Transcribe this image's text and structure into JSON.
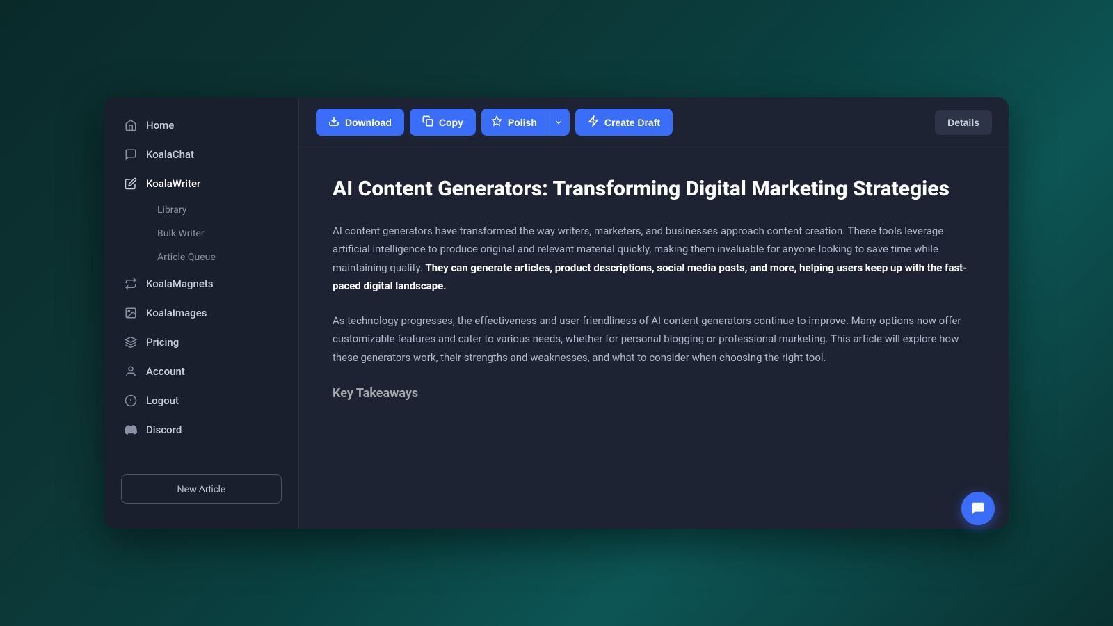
{
  "sidebar": {
    "items": [
      {
        "id": "home",
        "label": "Home",
        "icon": "home"
      },
      {
        "id": "koalachat",
        "label": "KoalaChat",
        "icon": "chat"
      },
      {
        "id": "koalawriter",
        "label": "KoalaWriter",
        "icon": "write"
      },
      {
        "id": "koalamagnets",
        "label": "KoalaMagnets",
        "icon": "magnets"
      },
      {
        "id": "koalaimages",
        "label": "KoalaImages",
        "icon": "images"
      },
      {
        "id": "pricing",
        "label": "Pricing",
        "icon": "pricing"
      },
      {
        "id": "account",
        "label": "Account",
        "icon": "account"
      },
      {
        "id": "logout",
        "label": "Logout",
        "icon": "logout"
      },
      {
        "id": "discord",
        "label": "Discord",
        "icon": "discord"
      }
    ],
    "sub_items": [
      {
        "id": "library",
        "label": "Library"
      },
      {
        "id": "bulk-writer",
        "label": "Bulk Writer"
      },
      {
        "id": "article-queue",
        "label": "Article Queue"
      }
    ],
    "new_article_label": "New Article"
  },
  "toolbar": {
    "download_label": "Download",
    "copy_label": "Copy",
    "polish_label": "Polish",
    "create_draft_label": "Create Draft",
    "details_label": "Details"
  },
  "article": {
    "title": "AI Content Generators: Transforming Digital Marketing Strategies",
    "paragraph1_normal": "AI content generators have transformed the way writers, marketers, and businesses approach content creation. These tools leverage artificial intelligence to produce original and relevant material quickly, making them invaluable for anyone looking to save time while maintaining quality. ",
    "paragraph1_bold": "They can generate articles, product descriptions, social media posts, and more, helping users keep up with the fast-paced digital landscape.",
    "paragraph2": "As technology progresses, the effectiveness and user-friendliness of AI content generators continue to improve. Many options now offer customizable features and cater to various needs, whether for personal blogging or professional marketing. This article will explore how these generators work, their strengths and weaknesses, and what to consider when choosing the right tool.",
    "section_title": "Key Takeaways"
  },
  "chat_icon": "💬",
  "colors": {
    "accent_blue": "#3b6ef8",
    "bg_dark": "#1a1f2e",
    "bg_main": "#1e2333",
    "text_primary": "#ffffff",
    "text_secondary": "#b0b8cc",
    "border": "#2a2f3e"
  }
}
